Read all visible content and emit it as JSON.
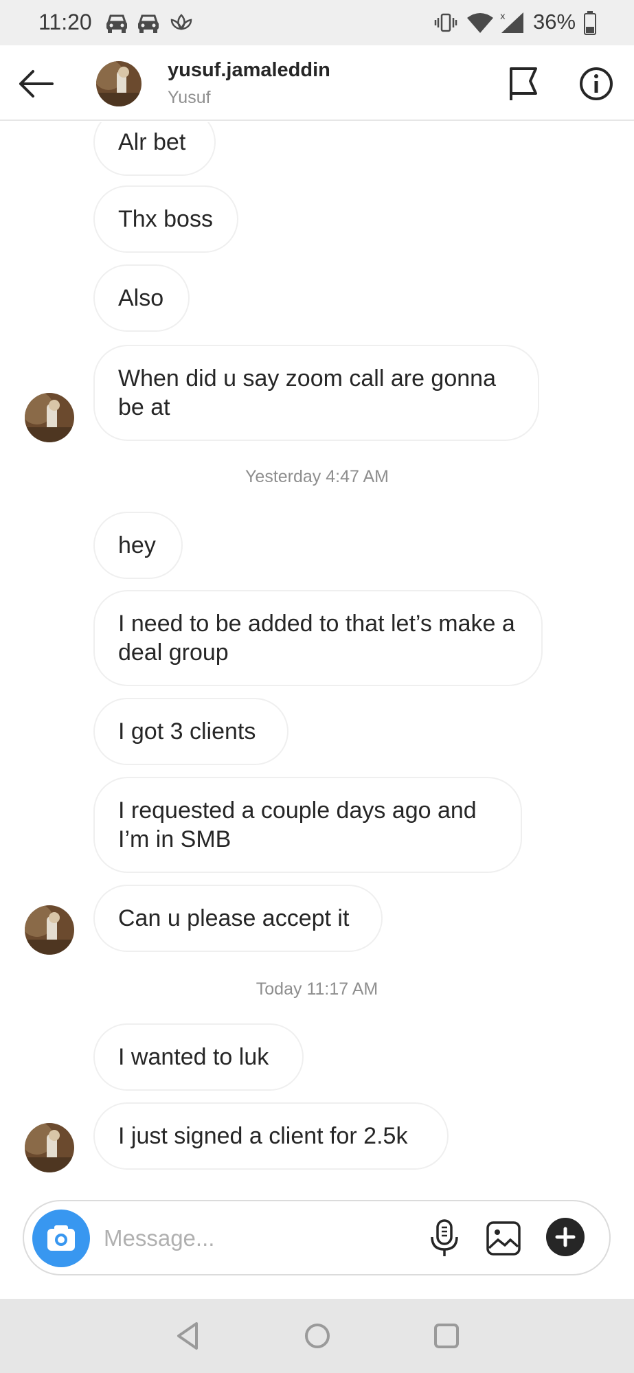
{
  "status_bar": {
    "time": "11:20",
    "battery_percent": "36%",
    "icons": [
      "car-icon",
      "car-icon",
      "lotus-icon",
      "vibrate-icon",
      "wifi-icon",
      "signal-icon",
      "battery-icon"
    ]
  },
  "header": {
    "username": "yusuf.jamaleddin",
    "display_name": "Yusuf",
    "icons": [
      "back-arrow-icon",
      "flag-icon",
      "info-icon"
    ]
  },
  "messages": [
    {
      "text": "Alr bet"
    },
    {
      "text": "Thx boss"
    },
    {
      "text": "Also"
    },
    {
      "text": "When did u say zoom call are gonna be at"
    },
    {
      "timestamp": "Yesterday 4:47 AM"
    },
    {
      "text": "hey"
    },
    {
      "text": "I need to be added to that let’s make a deal group"
    },
    {
      "text": "I got 3 clients"
    },
    {
      "text": "I requested a couple days ago and I’m in SMB"
    },
    {
      "text": "Can u please accept it"
    },
    {
      "timestamp": "Today 11:17 AM"
    },
    {
      "text": "I wanted to luk"
    },
    {
      "text": "I just signed a client for 2.5k"
    }
  ],
  "composer": {
    "placeholder": "Message...",
    "icons": [
      "camera-icon",
      "microphone-icon",
      "gallery-icon",
      "plus-icon"
    ]
  },
  "nav_bar": {
    "icons": [
      "back-triangle-icon",
      "home-circle-icon",
      "recents-square-icon"
    ]
  },
  "colors": {
    "accent": "#3897f0",
    "text": "#262626",
    "muted": "#8e8e8e",
    "bubble_border": "#efefef"
  }
}
